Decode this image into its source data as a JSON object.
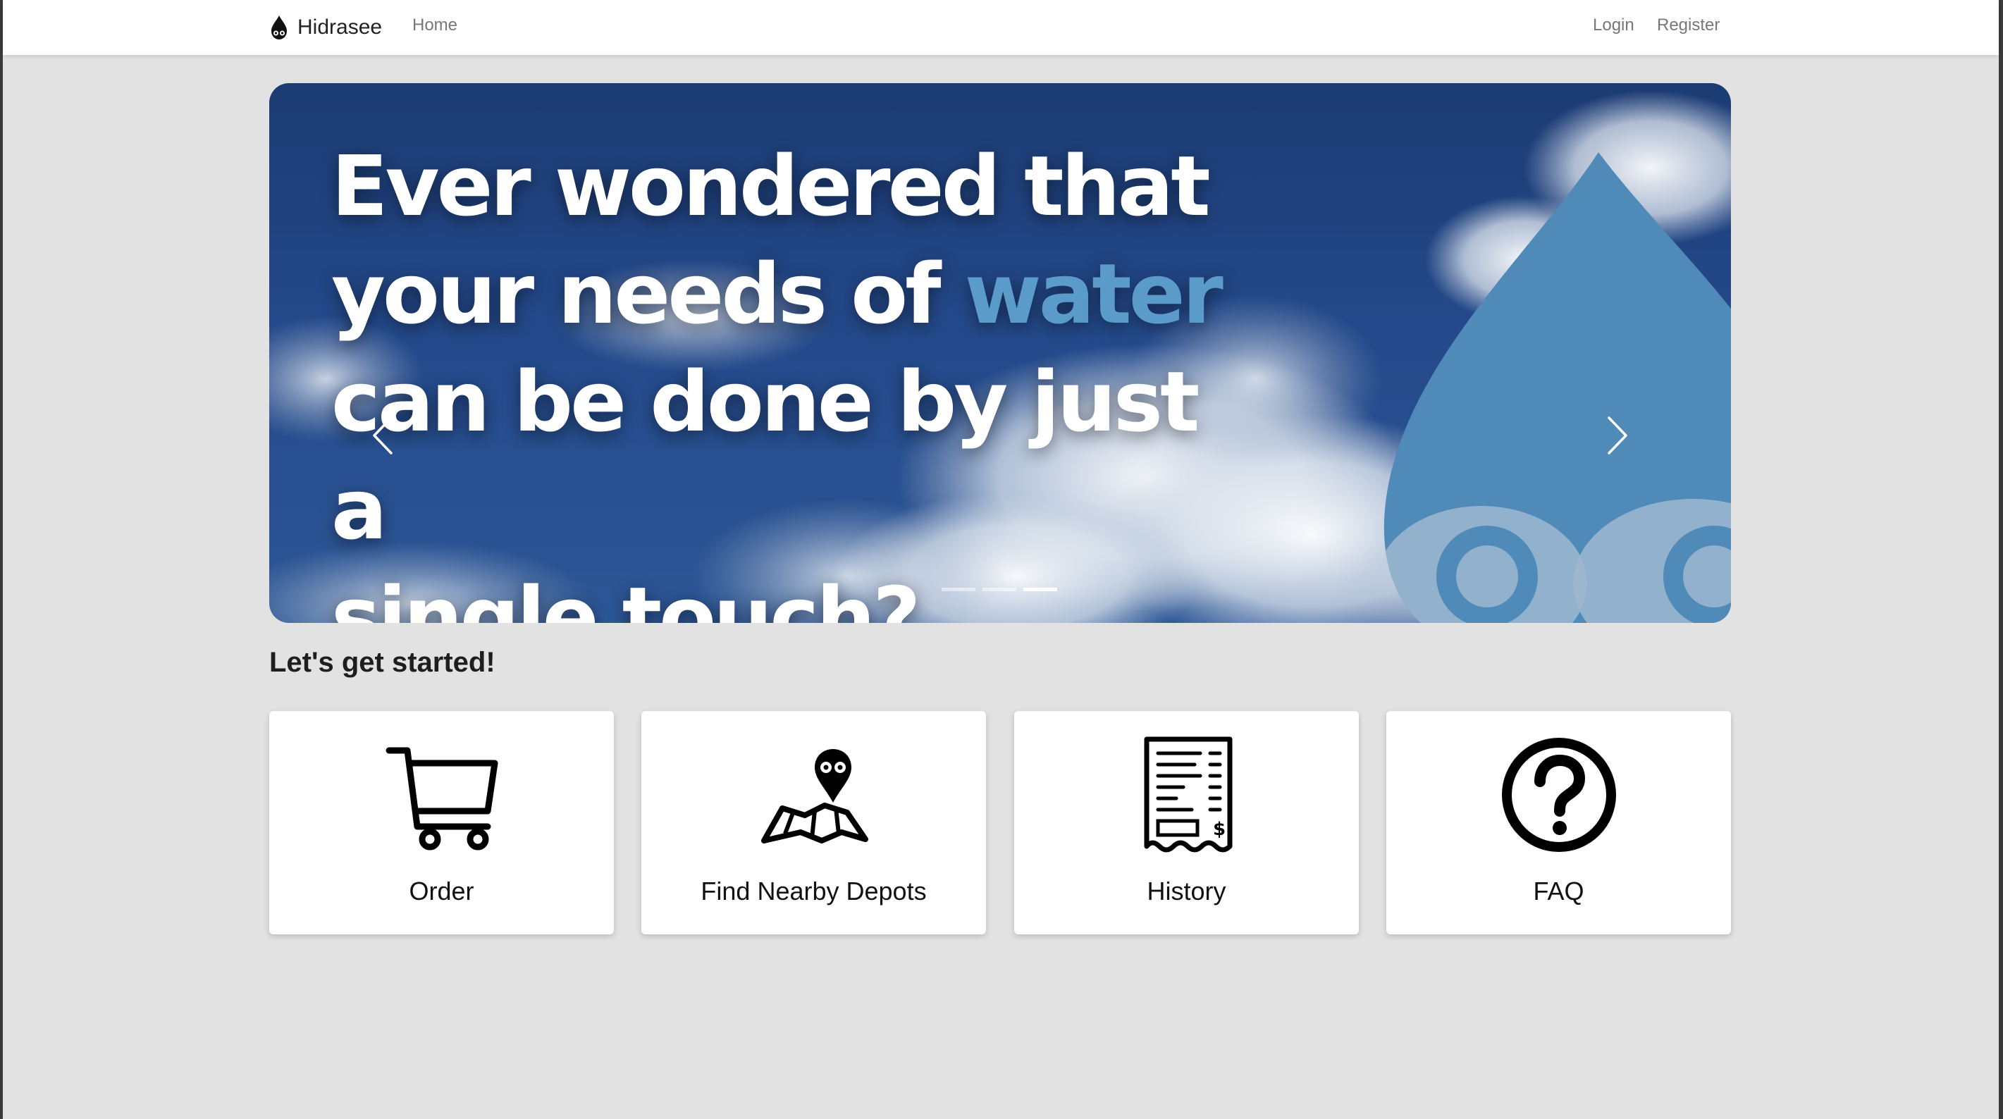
{
  "navbar": {
    "brand": "Hidrasee",
    "home": "Home",
    "login": "Login",
    "register": "Register"
  },
  "carousel": {
    "line1": "Ever wondered that",
    "line2_pre": "your needs of ",
    "line2_highlight": "water",
    "line3": "can be done by just a",
    "line4": "single touch?",
    "active_slide": 3,
    "slide_count": 3
  },
  "main": {
    "section_title": "Let's get started!",
    "cards": [
      {
        "label": "Order",
        "icon": "cart-icon"
      },
      {
        "label": "Find Nearby Depots",
        "icon": "map-pin-icon"
      },
      {
        "label": "History",
        "icon": "receipt-icon"
      },
      {
        "label": "FAQ",
        "icon": "question-icon"
      }
    ]
  },
  "colors": {
    "background": "#e2e2e2",
    "accent_water": "#5a9bc9",
    "drop_blue": "#4f8ab8",
    "sky_dark": "#1c3b73"
  }
}
